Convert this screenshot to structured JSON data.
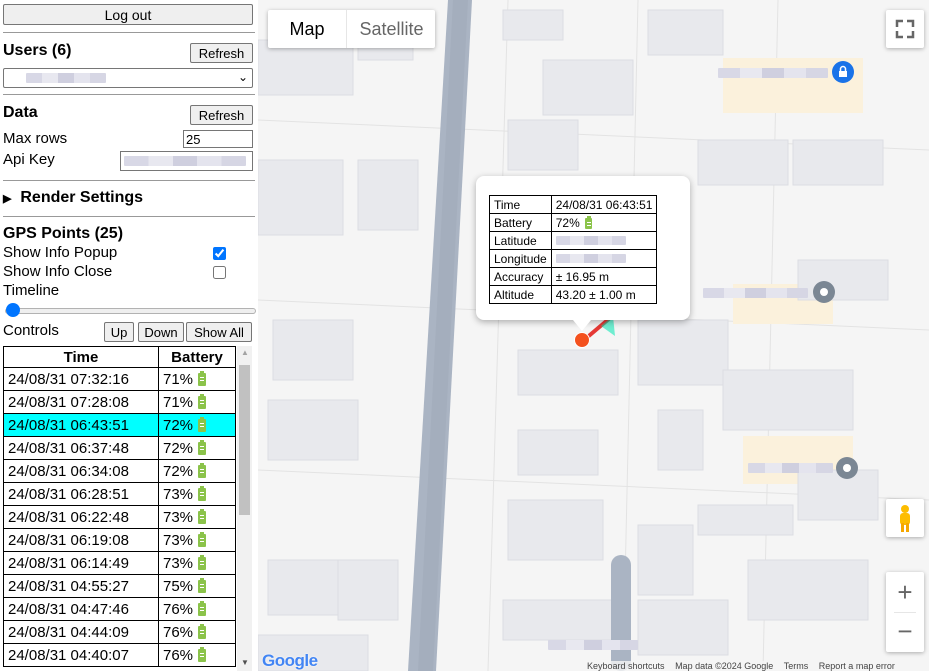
{
  "sidebar": {
    "logout_label": "Log out",
    "users": {
      "title": "Users (6)",
      "refresh_label": "Refresh"
    },
    "data": {
      "title": "Data",
      "refresh_label": "Refresh",
      "max_rows_label": "Max rows",
      "max_rows_value": "25",
      "api_key_label": "Api Key"
    },
    "render_settings_label": "Render Settings",
    "gps": {
      "title": "GPS Points (25)",
      "show_info_popup_label": "Show Info Popup",
      "show_info_popup_checked": true,
      "show_info_close_label": "Show Info Close",
      "show_info_close_checked": false,
      "timeline_label": "Timeline",
      "controls_label": "Controls",
      "up_label": "Up",
      "down_label": "Down",
      "show_all_label": "Show All"
    },
    "table": {
      "headers": [
        "Time",
        "Battery"
      ],
      "rows": [
        {
          "time": "24/08/31 07:32:16",
          "battery": "71%"
        },
        {
          "time": "24/08/31 07:28:08",
          "battery": "71%"
        },
        {
          "time": "24/08/31 06:43:51",
          "battery": "72%",
          "selected": true
        },
        {
          "time": "24/08/31 06:37:48",
          "battery": "72%"
        },
        {
          "time": "24/08/31 06:34:08",
          "battery": "72%"
        },
        {
          "time": "24/08/31 06:28:51",
          "battery": "73%"
        },
        {
          "time": "24/08/31 06:22:48",
          "battery": "73%"
        },
        {
          "time": "24/08/31 06:19:08",
          "battery": "73%"
        },
        {
          "time": "24/08/31 06:14:49",
          "battery": "73%"
        },
        {
          "time": "24/08/31 04:55:27",
          "battery": "75%"
        },
        {
          "time": "24/08/31 04:47:46",
          "battery": "76%"
        },
        {
          "time": "24/08/31 04:44:09",
          "battery": "76%"
        },
        {
          "time": "24/08/31 04:40:07",
          "battery": "76%"
        }
      ]
    }
  },
  "map": {
    "type_map_label": "Map",
    "type_satellite_label": "Satellite",
    "popup": {
      "time_label": "Time",
      "time_value": "24/08/31 06:43:51",
      "battery_label": "Battery",
      "battery_value": "72%",
      "latitude_label": "Latitude",
      "longitude_label": "Longitude",
      "accuracy_label": "Accuracy",
      "accuracy_value": "± 16.95 m",
      "altitude_label": "Altitude",
      "altitude_value": "43.20 ± 1.00 m"
    },
    "google_logo": "Google",
    "footer": [
      "Keyboard shortcuts",
      "Map data ©2024 Google",
      "Terms",
      "Report a map error"
    ],
    "colors": {
      "highlight": "#00ffff",
      "marker": "#f4511e",
      "track": "#e53935",
      "battery": "#8bc34a",
      "road": "#aab4c3"
    }
  }
}
